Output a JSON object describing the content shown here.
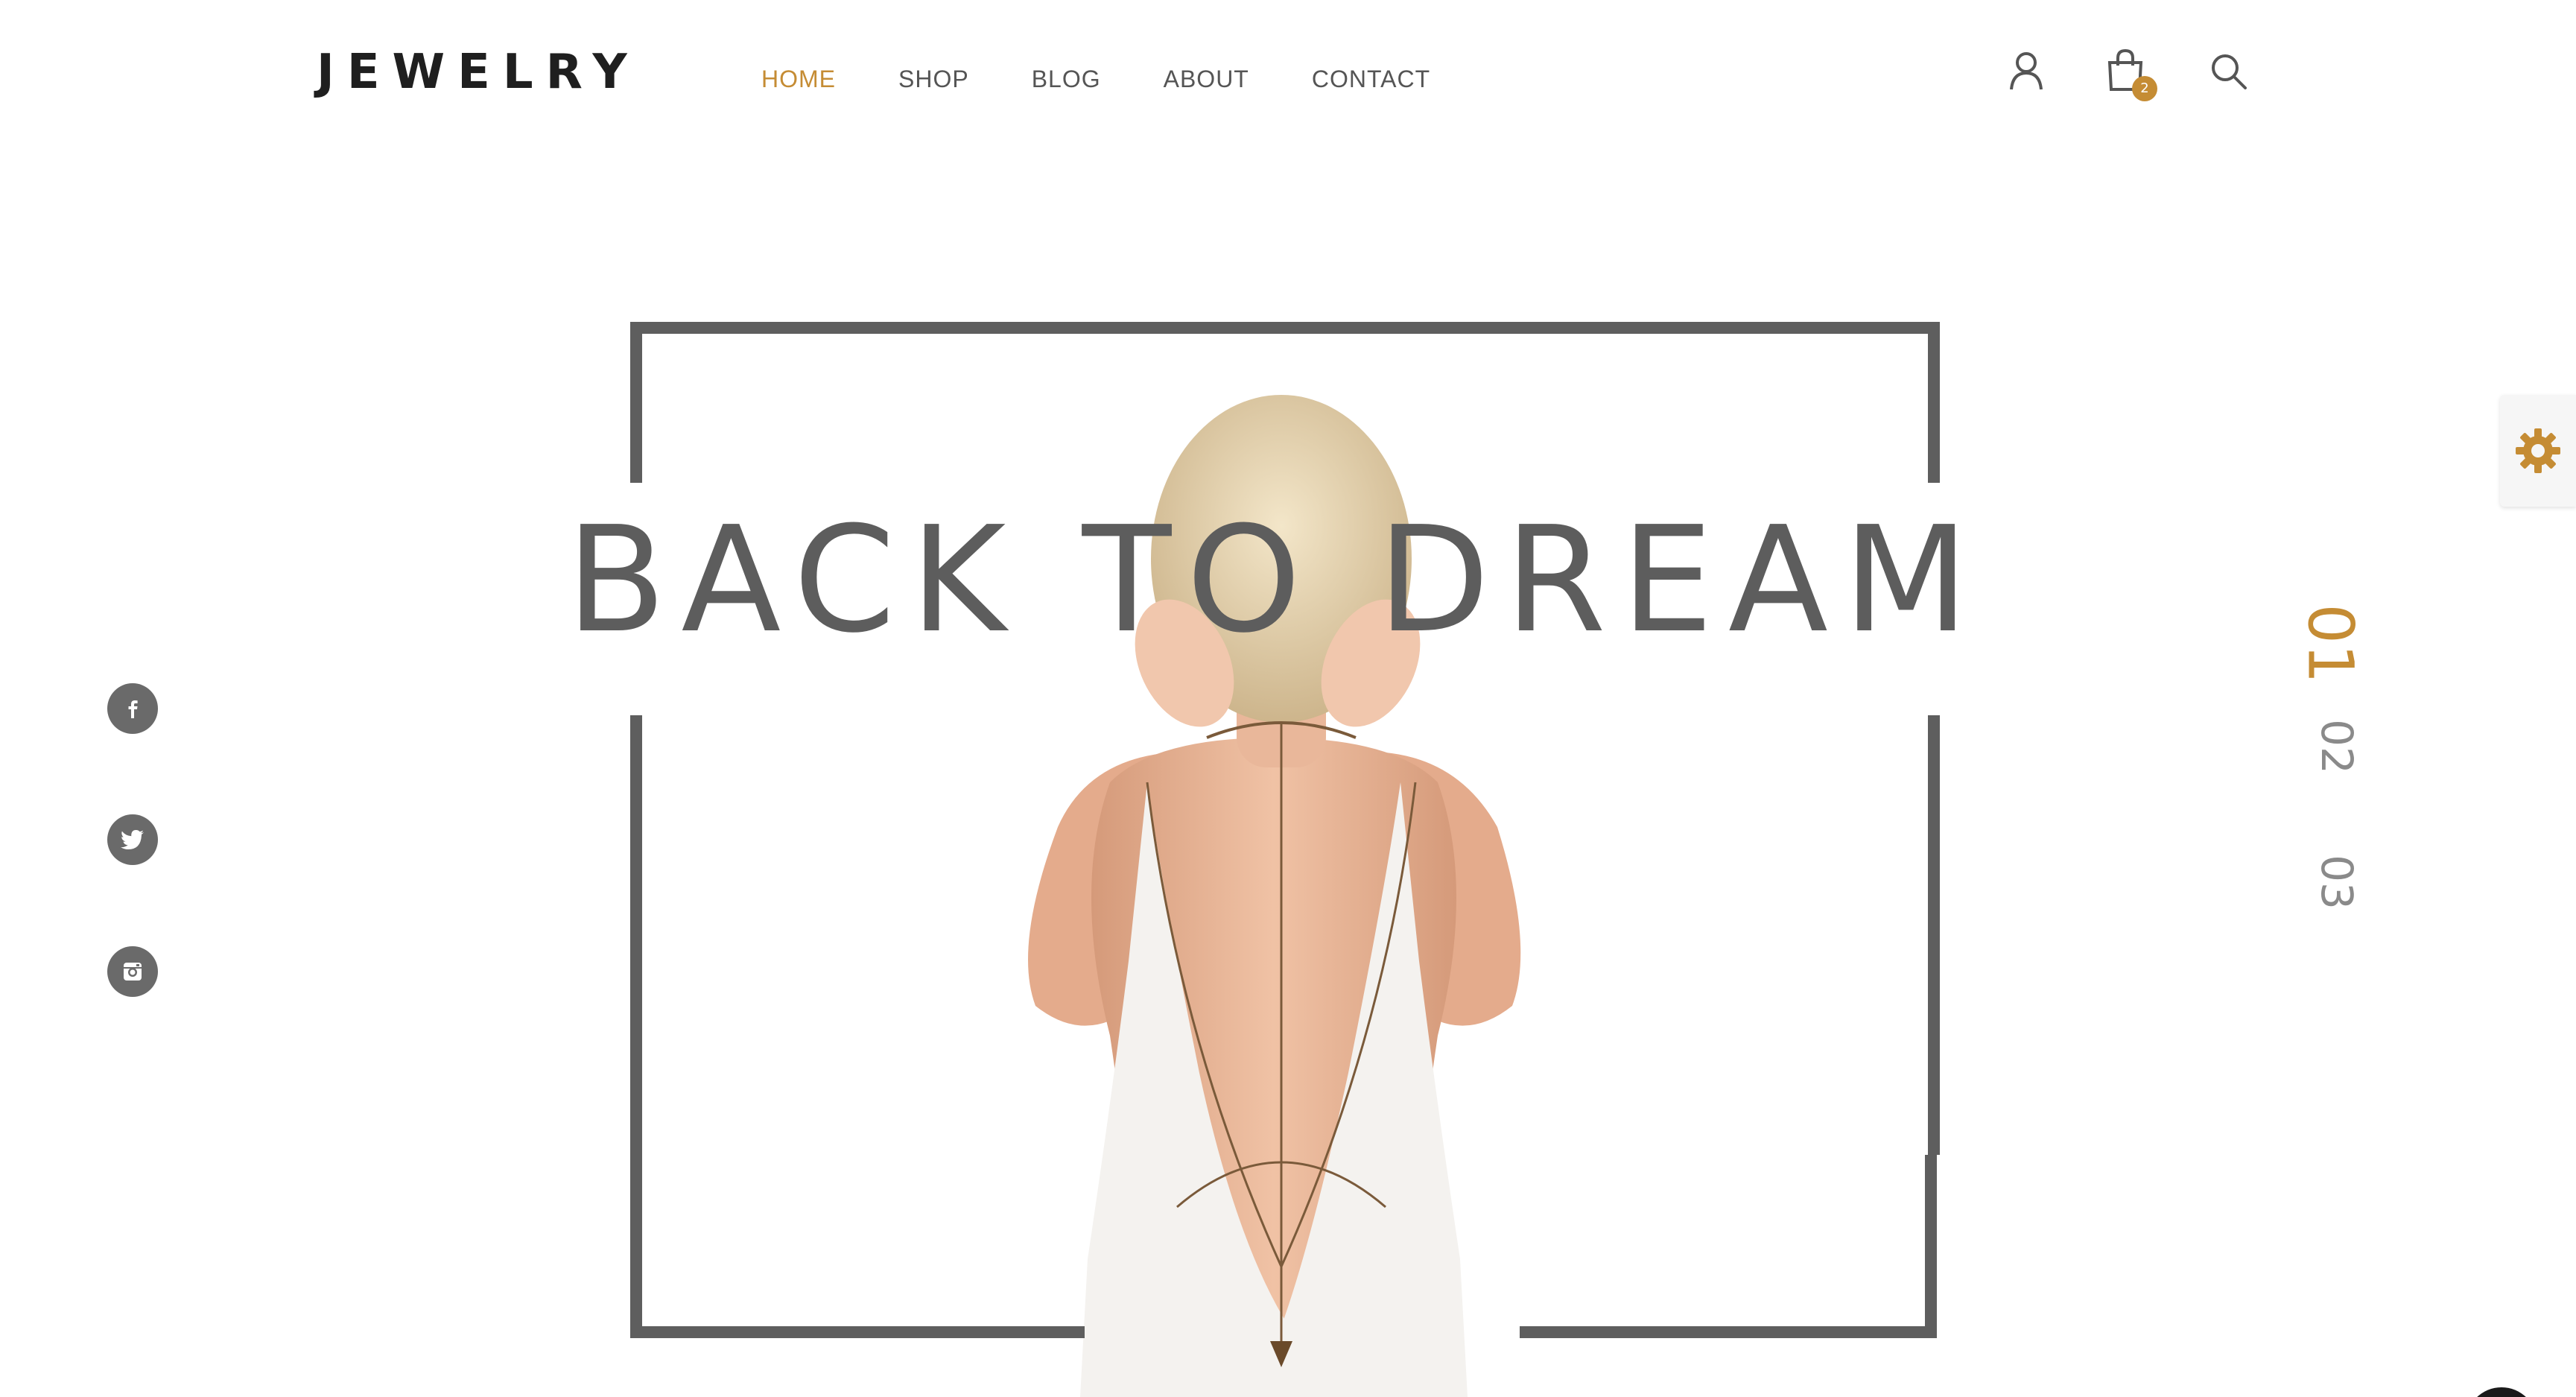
{
  "brand": {
    "logo": "JEWELRY"
  },
  "nav": {
    "items": [
      {
        "label": "HOME",
        "active": true
      },
      {
        "label": "SHOP",
        "active": false
      },
      {
        "label": "BLOG",
        "active": false
      },
      {
        "label": "ABOUT",
        "active": false
      },
      {
        "label": "CONTACT",
        "active": false
      }
    ]
  },
  "header_icons": {
    "account": "user-icon",
    "cart": "shopping-bag-icon",
    "cart_count": "2",
    "search": "search-icon"
  },
  "social": [
    {
      "icon": "facebook-icon",
      "glyph": "f"
    },
    {
      "icon": "twitter-icon",
      "glyph": "t"
    },
    {
      "icon": "instagram-icon",
      "glyph": "ig"
    }
  ],
  "hero": {
    "headline": "BACK TO DREAM"
  },
  "slider": {
    "indicators": [
      "01",
      "02",
      "03"
    ],
    "active_index": 0
  },
  "colors": {
    "accent": "#c58c34",
    "text_dark": "#1f1f1f",
    "frame": "#5e5e5e",
    "social_bg": "#6a6a6a"
  }
}
